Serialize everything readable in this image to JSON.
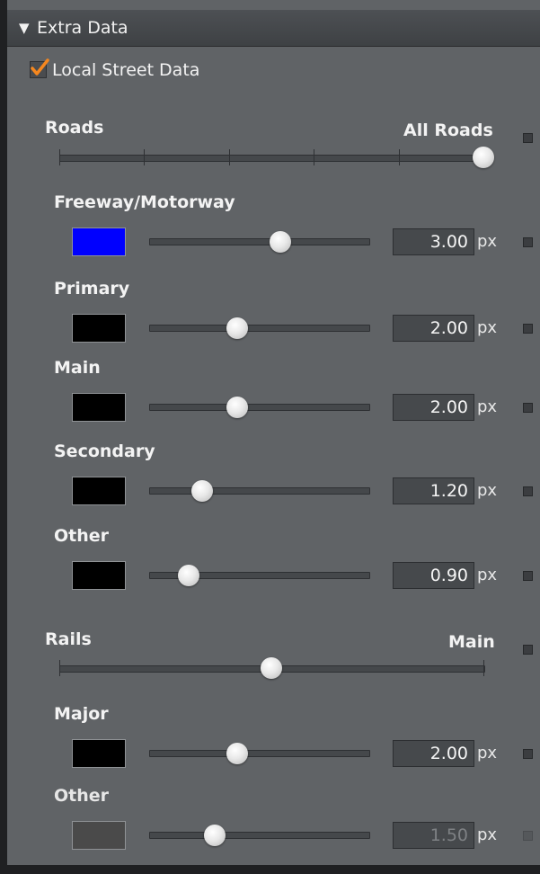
{
  "panel": {
    "section_title": "Extra Data",
    "expanded": true
  },
  "local_street": {
    "label": "Local Street Data",
    "checked": true,
    "accent": "#f5871f"
  },
  "roads": {
    "label": "Roads",
    "value_label": "All Roads",
    "level": 1.0,
    "tick_count": 6
  },
  "road_types": [
    {
      "label": "Freeway/Motorway",
      "color": "#0000ff",
      "width": "3.00",
      "unit": "px",
      "slider": 0.6
    },
    {
      "label": "Primary",
      "color": "#000000",
      "width": "2.00",
      "unit": "px",
      "slider": 0.4
    },
    {
      "label": "Main",
      "color": "#000000",
      "width": "2.00",
      "unit": "px",
      "slider": 0.4
    },
    {
      "label": "Secondary",
      "color": "#000000",
      "width": "1.20",
      "unit": "px",
      "slider": 0.24
    },
    {
      "label": "Other",
      "color": "#000000",
      "width": "0.90",
      "unit": "px",
      "slider": 0.18
    }
  ],
  "rails": {
    "label": "Rails",
    "value_label": "Main",
    "level": 0.5
  },
  "rail_types": [
    {
      "label": "Major",
      "color": "#000000",
      "width": "2.00",
      "unit": "px",
      "slider": 0.4,
      "enabled": true
    },
    {
      "label": "Other",
      "color": "#4a4a4a",
      "width": "1.50",
      "unit": "px",
      "slider": 0.3,
      "enabled": false
    }
  ]
}
